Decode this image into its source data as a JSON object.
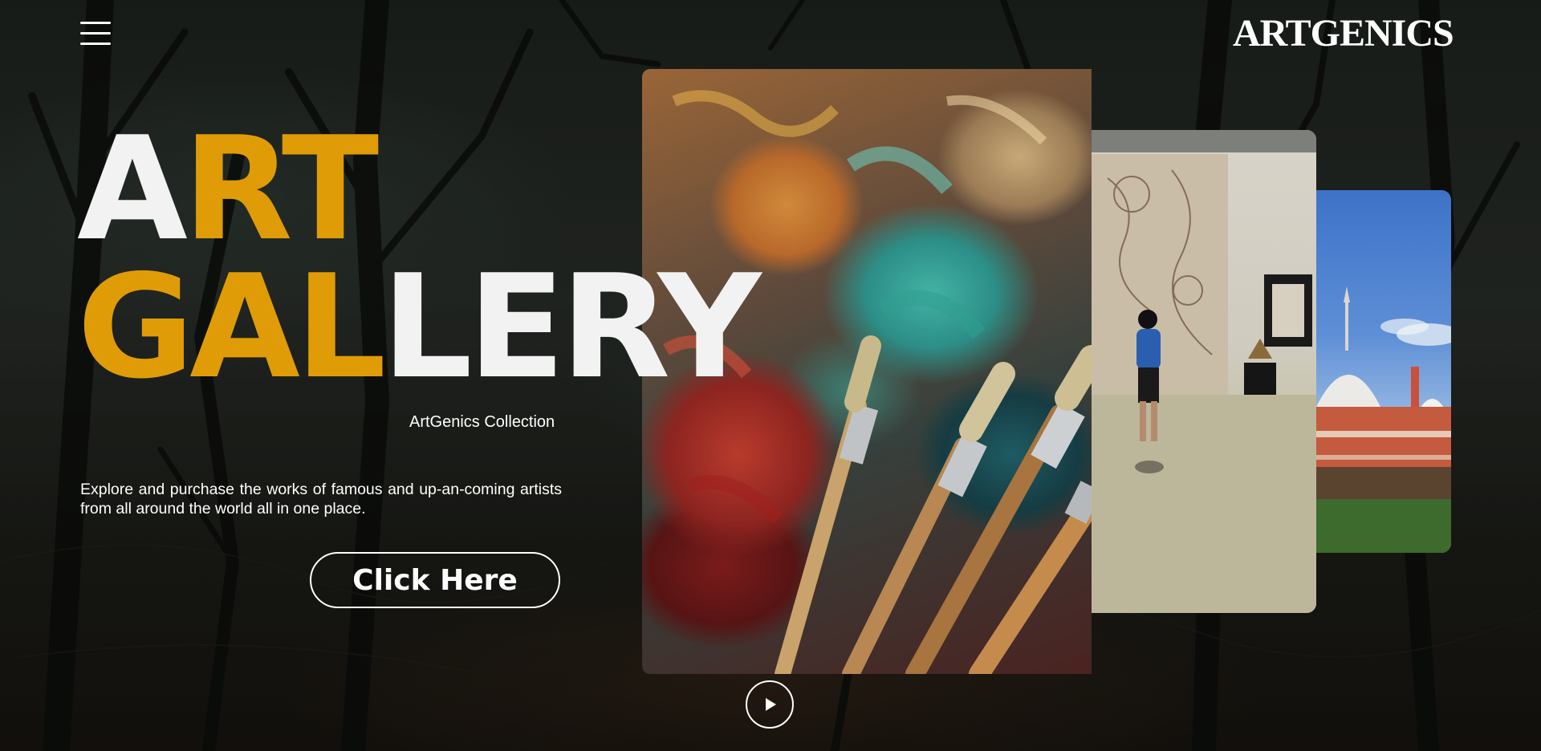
{
  "header": {
    "brand": "ARTGENICS",
    "menu_icon": "hamburger-menu-icon"
  },
  "hero": {
    "title_line1": [
      {
        "text": "A",
        "tone": "white"
      },
      {
        "text": "RT",
        "tone": "orange"
      }
    ],
    "title_line1_rest": "",
    "title_line2_orange": "GAL",
    "title_line2_white": "LERY",
    "subtitle": "ArtGenics Collection",
    "description": "Explore and purchase the works of famous and up-an-coming artists from all around the world all in one place.",
    "cta_label": "Click Here"
  },
  "gallery": {
    "cards": [
      {
        "subject": "oil paint palette with brushes"
      },
      {
        "subject": "visitor viewing artwork in a gallery"
      },
      {
        "subject": "domed mosque against blue sky"
      }
    ],
    "play_icon": "play-icon"
  },
  "colors": {
    "accent": "#e09c06",
    "title_white": "#f2f2f2",
    "background": "#161a17"
  }
}
